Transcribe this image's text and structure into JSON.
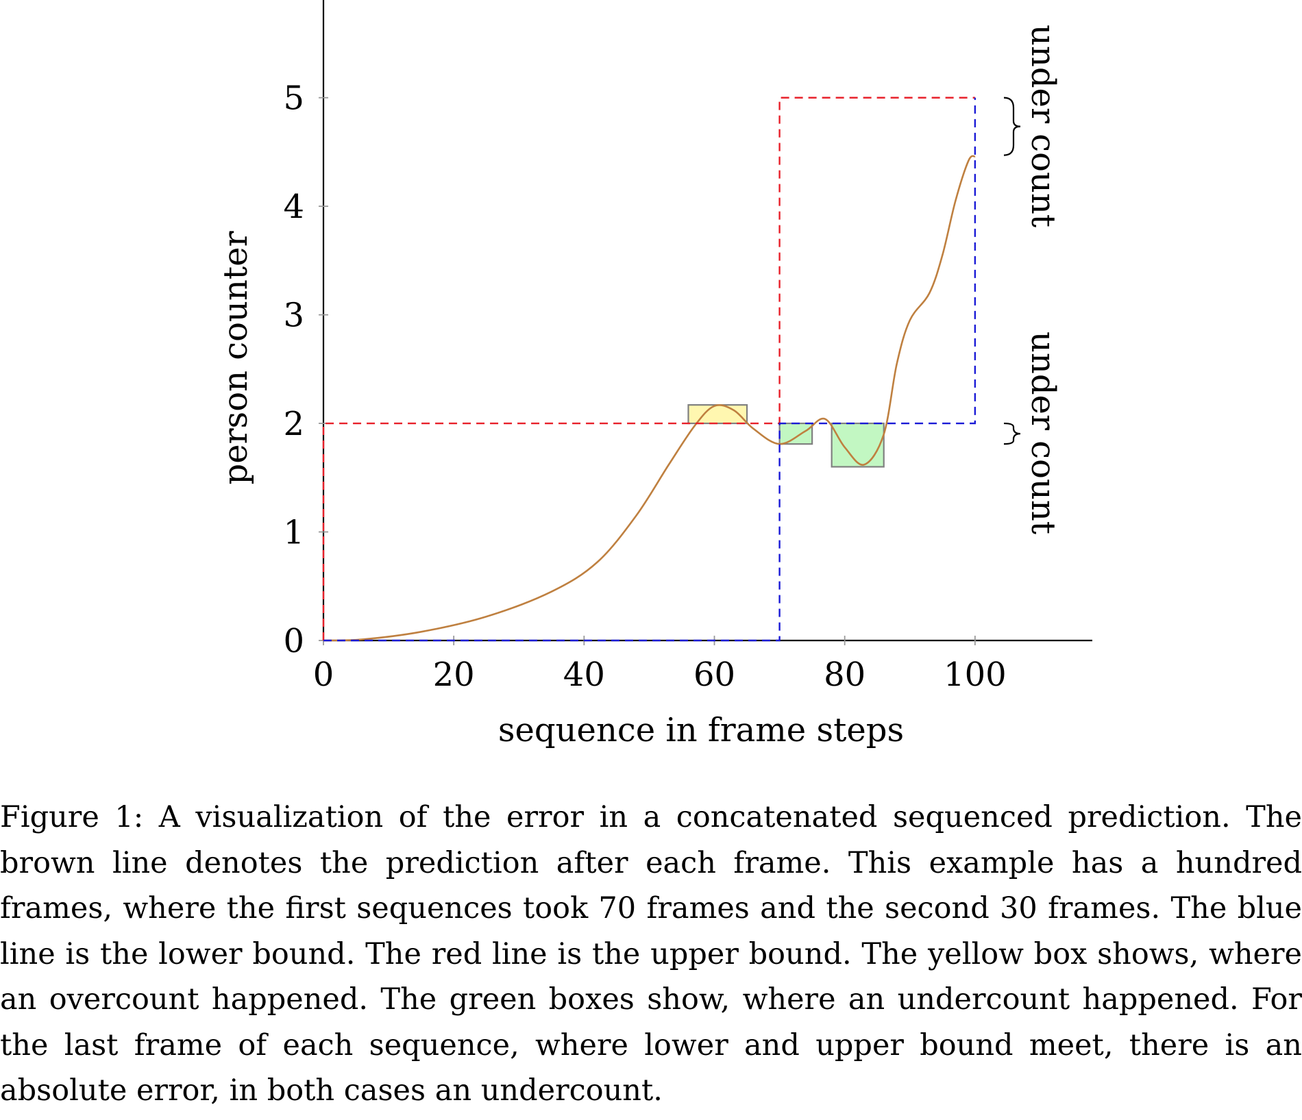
{
  "chart_data": {
    "type": "line",
    "xlabel": "sequence in frame steps",
    "ylabel": "person counter",
    "xlim": [
      0,
      118
    ],
    "ylim": [
      0,
      5.9
    ],
    "xticks": [
      0,
      20,
      40,
      60,
      80,
      100
    ],
    "yticks": [
      0,
      1,
      2,
      3,
      4,
      5
    ],
    "grid": false,
    "colors": {
      "prediction": "#bf8040",
      "upper_bound": "#e8202a",
      "lower_bound": "#1a1ad6",
      "overcount_fill": "#fff7b0",
      "undercount_fill": "#c2f7c2",
      "box_stroke": "#808080"
    },
    "series": [
      {
        "role": "prediction",
        "x": [
          0,
          6,
          15,
          25,
          35,
          42,
          48,
          53,
          57,
          60,
          63,
          66,
          70,
          74,
          77,
          80,
          83,
          86,
          88,
          90,
          93,
          95,
          97,
          99,
          100
        ],
        "y": [
          0,
          0.01,
          0.08,
          0.22,
          0.45,
          0.72,
          1.15,
          1.62,
          1.98,
          2.16,
          2.12,
          1.95,
          1.81,
          1.93,
          2.04,
          1.78,
          1.62,
          1.9,
          2.55,
          2.95,
          3.2,
          3.55,
          4.05,
          4.42,
          4.46
        ]
      },
      {
        "role": "upper_bound",
        "x": [
          0,
          0,
          70,
          70,
          100
        ],
        "y": [
          0,
          2,
          2,
          5,
          5
        ]
      },
      {
        "role": "lower_bound",
        "x": [
          0,
          70,
          70,
          100,
          100
        ],
        "y": [
          0,
          0,
          2,
          2,
          5
        ]
      }
    ],
    "boxes": [
      {
        "kind": "overcount",
        "x": [
          56,
          65
        ],
        "y": [
          2,
          2.17
        ]
      },
      {
        "kind": "undercount",
        "x": [
          70,
          75
        ],
        "y": [
          1.81,
          2
        ]
      },
      {
        "kind": "undercount",
        "x": [
          78,
          86
        ],
        "y": [
          1.6,
          2
        ]
      }
    ],
    "annotations": [
      {
        "text": "under count",
        "brace_y": [
          4.47,
          5
        ]
      },
      {
        "text": "under count",
        "brace_y": [
          1.81,
          2
        ]
      }
    ]
  },
  "caption": "Figure 1: A visualization of the error in a concatenated sequenced prediction. The brown line denotes the prediction after each frame. This example has a hundred frames, where the first sequences took 70 frames and the second 30 frames. The blue line is the lower bound. The red line is the upper bound. The yellow box shows, where an overcount happened. The green boxes show, where an undercount happened. For the last frame of each sequence, where lower and upper bound meet, there is an absolute error, in both cases an undercount."
}
